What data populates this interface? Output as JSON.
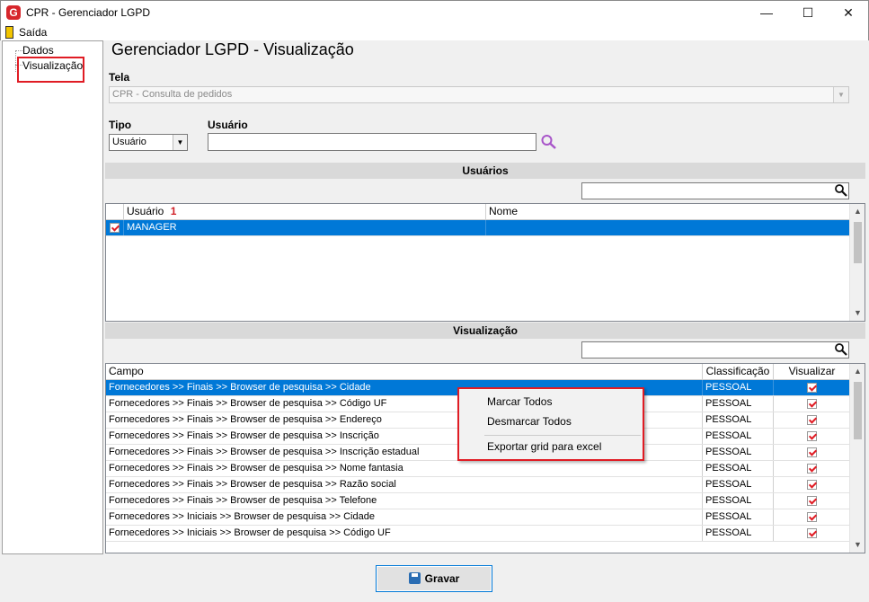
{
  "window": {
    "title": "CPR - Gerenciador LGPD",
    "app_icon": "G",
    "minimize": "—",
    "maximize": "☐",
    "close": "✕"
  },
  "menu": {
    "exit_label": "Saída"
  },
  "tree": {
    "items": [
      "Dados",
      "Visualização"
    ]
  },
  "page": {
    "title": "Gerenciador LGPD - Visualização"
  },
  "tela": {
    "label": "Tela",
    "value": "CPR - Consulta de pedidos"
  },
  "tipo": {
    "label": "Tipo",
    "value": "Usuário"
  },
  "usuario": {
    "label": "Usuário",
    "value": ""
  },
  "usuarios_section": {
    "title": "Usuários",
    "search_value": "",
    "columns": [
      "Usuário",
      "Nome"
    ],
    "sort_indicator": "1",
    "rows": [
      {
        "checked": true,
        "usuario": "MANAGER",
        "nome": ""
      }
    ]
  },
  "visualizacao_section": {
    "title": "Visualização",
    "search_value": "",
    "columns": [
      "Campo",
      "Classificação",
      "Visualizar"
    ],
    "rows": [
      {
        "campo": "Fornecedores >> Finais >> Browser de pesquisa >> Cidade",
        "classificacao": "PESSOAL",
        "visualizar": true
      },
      {
        "campo": "Fornecedores >> Finais >> Browser de pesquisa >> Código UF",
        "classificacao": "PESSOAL",
        "visualizar": true
      },
      {
        "campo": "Fornecedores >> Finais >> Browser de pesquisa >> Endereço",
        "classificacao": "PESSOAL",
        "visualizar": true
      },
      {
        "campo": "Fornecedores >> Finais >> Browser de pesquisa >> Inscrição",
        "classificacao": "PESSOAL",
        "visualizar": true
      },
      {
        "campo": "Fornecedores >> Finais >> Browser de pesquisa >> Inscrição estadual",
        "classificacao": "PESSOAL",
        "visualizar": true
      },
      {
        "campo": "Fornecedores >> Finais >> Browser de pesquisa >> Nome fantasia",
        "classificacao": "PESSOAL",
        "visualizar": true
      },
      {
        "campo": "Fornecedores >> Finais >> Browser de pesquisa >> Razão social",
        "classificacao": "PESSOAL",
        "visualizar": true
      },
      {
        "campo": "Fornecedores >> Finais >> Browser de pesquisa >> Telefone",
        "classificacao": "PESSOAL",
        "visualizar": true
      },
      {
        "campo": "Fornecedores >> Iniciais >> Browser de pesquisa >> Cidade",
        "classificacao": "PESSOAL",
        "visualizar": true
      },
      {
        "campo": "Fornecedores >> Iniciais >> Browser de pesquisa >> Código UF",
        "classificacao": "PESSOAL",
        "visualizar": true
      }
    ]
  },
  "context_menu": {
    "items": [
      "Marcar Todos",
      "Desmarcar Todos",
      "Exportar grid para excel"
    ]
  },
  "actions": {
    "save_label": "Gravar"
  },
  "colors": {
    "selection": "#0078d7",
    "highlight": "#e01c24",
    "search_icon": "#a855c9"
  }
}
